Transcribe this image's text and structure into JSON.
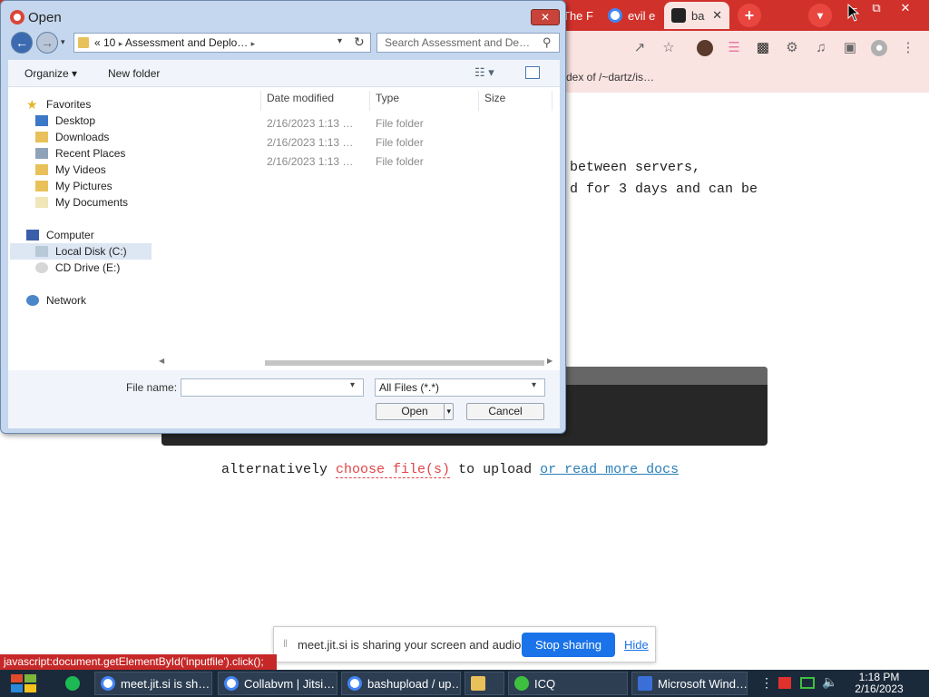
{
  "browser": {
    "tabs": [
      {
        "label": "The F"
      },
      {
        "label": "evil e"
      },
      {
        "label": "ba"
      }
    ],
    "bookmark_text": "dex of /~dartz/is…",
    "new_tab_glyph": "+",
    "tab_close_glyph": "✕",
    "window_controls": [
      "‒",
      "⧉",
      "✕"
    ]
  },
  "page": {
    "line1": "between servers,",
    "line2": "d for 3 days and can be",
    "alt_prefix": "alternatively ",
    "alt_link": "choose file(s)",
    "alt_mid": " to upload ",
    "alt_docs": "or read more docs"
  },
  "dialog": {
    "title": "Open",
    "close_glyph": "✕",
    "address": {
      "prefix": "« 10",
      "sep": "▸",
      "folder": "Assessment and Deplo…"
    },
    "search_placeholder": "Search Assessment and De…",
    "commands": {
      "organize": "Organize ▾",
      "new_folder": "New folder"
    },
    "nav": {
      "favorites": "Favorites",
      "desktop": "Desktop",
      "downloads": "Downloads",
      "recent": "Recent Places",
      "videos": "My Videos",
      "pictures": "My Pictures",
      "documents": "My Documents",
      "computer": "Computer",
      "local_disk": "Local Disk (C:)",
      "cd_drive": "CD Drive (E:)",
      "network": "Network"
    },
    "columns": {
      "date": "Date modified",
      "type": "Type",
      "size": "Size"
    },
    "rows": [
      {
        "date": "2/16/2023 1:13 …",
        "type": "File folder"
      },
      {
        "date": "2/16/2023 1:13 …",
        "type": "File folder"
      },
      {
        "date": "2/16/2023 1:13 …",
        "type": "File folder"
      }
    ],
    "file_name_label": "File name:",
    "file_name_value": "",
    "file_type": "All Files (*.*)",
    "open_label": "Open",
    "cancel_label": "Cancel"
  },
  "share_bar": {
    "text": "meet.jit.si is sharing your screen and audio.",
    "stop": "Stop sharing",
    "hide": "Hide"
  },
  "status_bar": "javascript:document.getElementById('inputfile').click();",
  "taskbar": {
    "tasks": [
      {
        "label": "meet.jit.si is sh…"
      },
      {
        "label": "Collabvm | Jitsi…"
      },
      {
        "label": "bashupload / up…"
      },
      {
        "label": ""
      },
      {
        "label": "ICQ"
      },
      {
        "label": "Microsoft Wind…"
      }
    ],
    "time": "1:18 PM",
    "date": "2/16/2023"
  },
  "colors": {
    "tab_strip": "#d0322b",
    "toolbar": "#fae4e2",
    "dialog_frame": "#c4d7ee",
    "share_button": "#1a73e8",
    "status_bar": "#c62828",
    "taskbar": "#1b2a3a"
  }
}
